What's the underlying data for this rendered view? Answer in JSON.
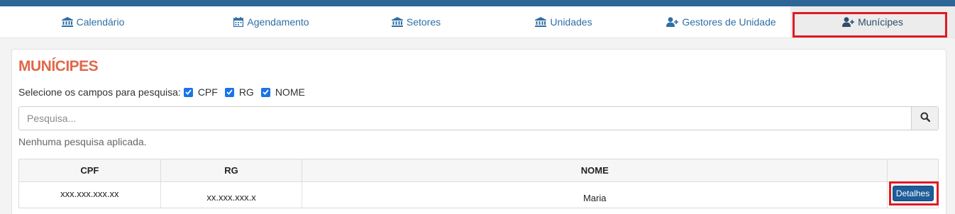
{
  "nav": {
    "tabs": [
      {
        "label": "Calendário",
        "icon": "institution-icon"
      },
      {
        "label": "Agendamento",
        "icon": "calendar-icon"
      },
      {
        "label": "Setores",
        "icon": "institution-icon"
      },
      {
        "label": "Unidades",
        "icon": "institution-icon"
      },
      {
        "label": "Gestores de Unidade",
        "icon": "user-plus-icon"
      },
      {
        "label": "Munícipes",
        "icon": "user-plus-icon",
        "active": true
      }
    ]
  },
  "page": {
    "title": "MUNÍCIPES"
  },
  "filters": {
    "label": "Selecione os campos para pesquisa:",
    "options": [
      {
        "label": "CPF",
        "checked": true
      },
      {
        "label": "RG",
        "checked": true
      },
      {
        "label": "NOME",
        "checked": true
      }
    ]
  },
  "search": {
    "placeholder": "Pesquisa...",
    "value": ""
  },
  "status": "Nenhuma pesquisa aplicada.",
  "table": {
    "headers": [
      "CPF",
      "RG",
      "NOME",
      ""
    ],
    "rows": [
      {
        "cpf": "xxx.xxx.xxx.xx",
        "rg": "xx.xxx.xxx.x",
        "nome": "Maria",
        "action": "Detalhes"
      }
    ]
  },
  "colors": {
    "brand": "#2e6696",
    "accent": "#e0674a",
    "highlight": "#e01a24",
    "button": "#1d5d99",
    "checkbox": "#1a73e8"
  }
}
